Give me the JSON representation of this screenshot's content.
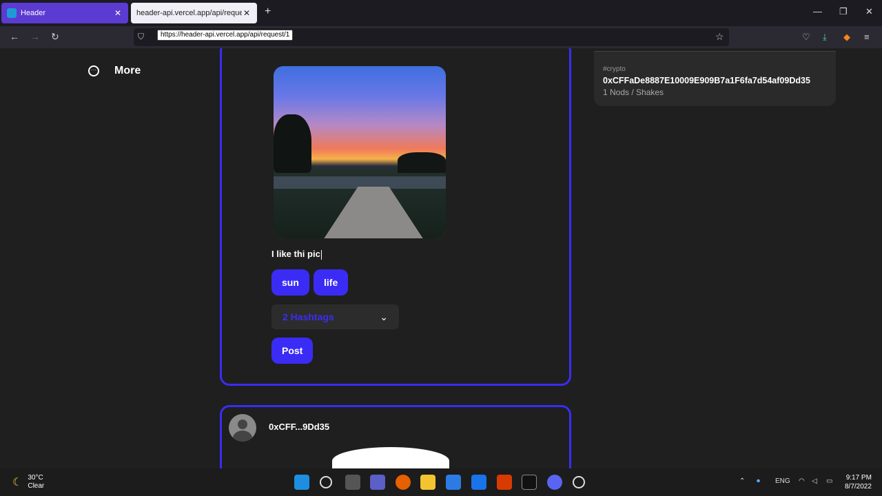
{
  "browser": {
    "tabs": [
      {
        "title": "Header"
      },
      {
        "title": "header-api.vercel.app/api/request/1"
      }
    ],
    "url_tooltip": "https://header-api.vercel.app/api/request/1"
  },
  "sidebar": {
    "more_label": "More"
  },
  "post_composer": {
    "caption": "I like thi pic",
    "hashtags": [
      "sun",
      "life"
    ],
    "hashtag_dropdown": "2 Hashtags",
    "post_label": "Post"
  },
  "feed_post": {
    "author": "0xCFF...9Dd35"
  },
  "trending": {
    "tag": "#crypto",
    "address": "0xCFFaDe8887E10009E909B7a1F6fa7d54af09Dd35",
    "meta": "1 Nods / Shakes"
  },
  "taskbar": {
    "temperature": "30°C",
    "condition": "Clear",
    "language": "ENG",
    "time": "9:17 PM",
    "date": "8/7/2022"
  },
  "colors": {
    "accent": "#3b2cf5",
    "background": "#1f1f1f"
  }
}
